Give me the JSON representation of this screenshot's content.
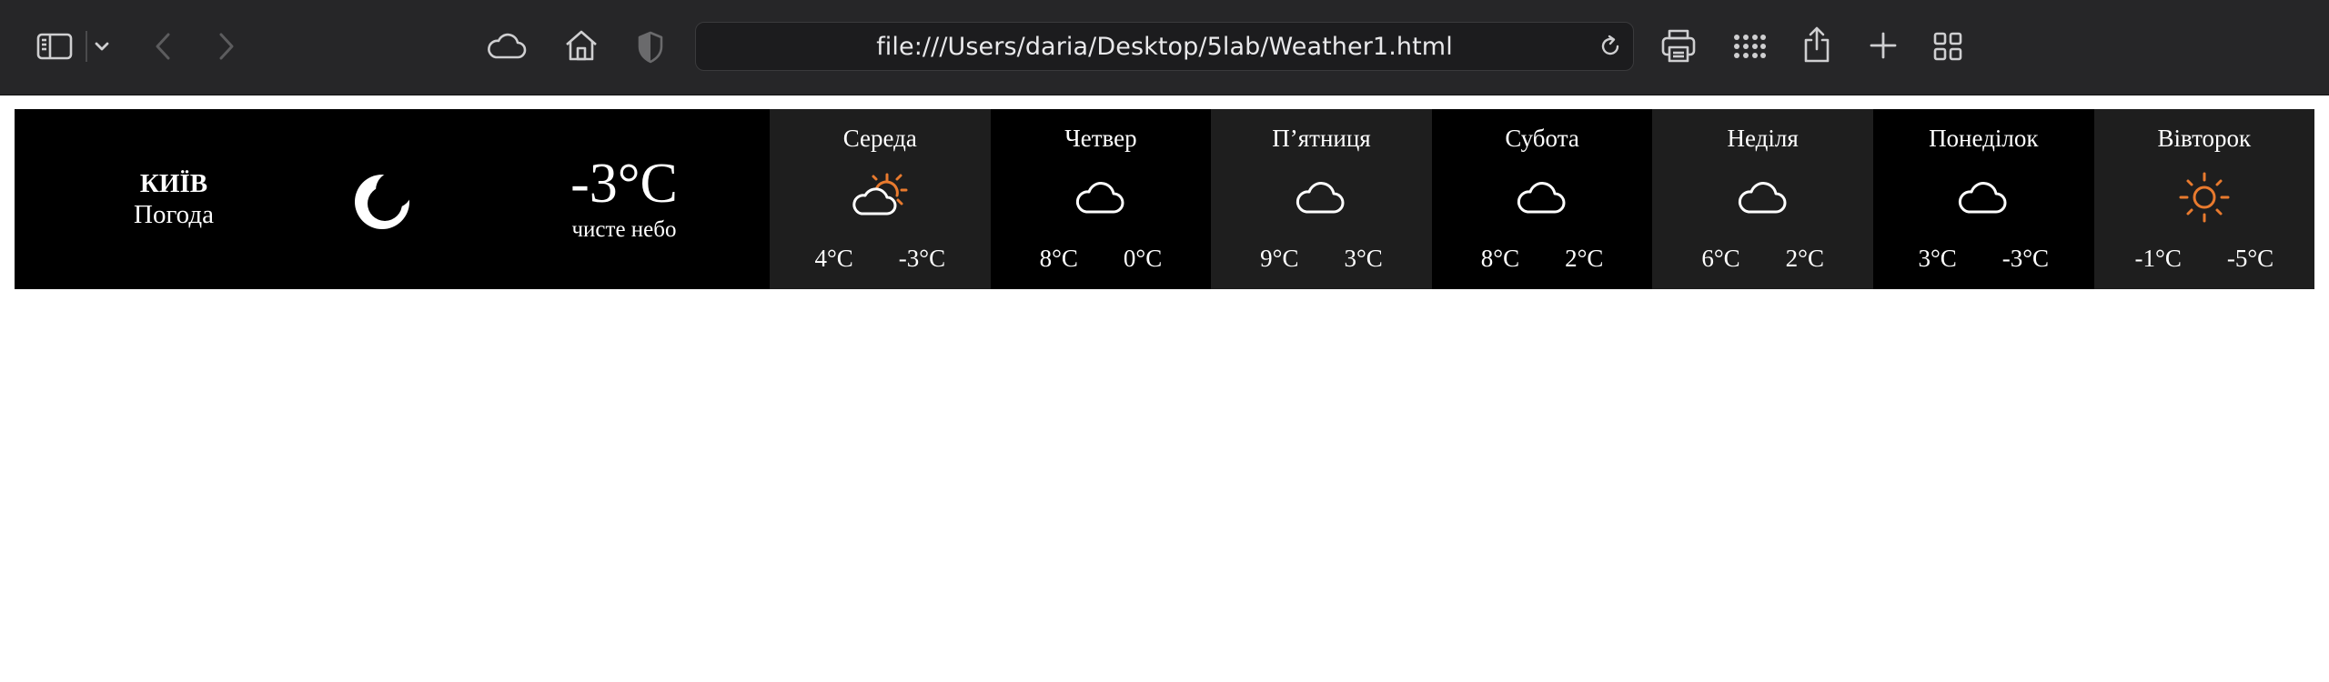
{
  "browser": {
    "url": "file:///Users/daria/Desktop/5lab/Weather1.html",
    "icons": {
      "sidebar": "sidebar-icon",
      "tabgroup_chevron": "chevron-down-icon",
      "back": "back-arrow-icon",
      "forward": "forward-arrow-icon",
      "icloud": "cloud-icon",
      "home": "home-icon",
      "privacy": "shield-icon",
      "reload": "reload-icon",
      "print": "printer-icon",
      "extensions": "grid-dots-icon",
      "share": "share-icon",
      "new_tab": "plus-icon",
      "tab_overview": "tab-overview-icon"
    }
  },
  "weather": {
    "city": "КИЇВ",
    "subtitle": "Погода",
    "current": {
      "icon": "moon-icon",
      "temp": "-3°C",
      "description": "чисте небо"
    },
    "forecast": [
      {
        "day": "Середа",
        "icon": "cloud-sun-icon",
        "high": "4°C",
        "low": "-3°C"
      },
      {
        "day": "Четвер",
        "icon": "cloud-icon",
        "high": "8°C",
        "low": "0°C"
      },
      {
        "day": "П’ятниця",
        "icon": "cloud-icon",
        "high": "9°C",
        "low": "3°C"
      },
      {
        "day": "Субота",
        "icon": "cloud-icon",
        "high": "8°C",
        "low": "2°C"
      },
      {
        "day": "Неділя",
        "icon": "cloud-icon",
        "high": "6°C",
        "low": "2°C"
      },
      {
        "day": "Понеділок",
        "icon": "cloud-icon",
        "high": "3°C",
        "low": "-3°C"
      },
      {
        "day": "Вівторок",
        "icon": "sun-icon",
        "high": "-1°C",
        "low": "-5°C"
      }
    ],
    "colors": {
      "background": "#000000",
      "alt_background": "#1e1e1e",
      "text": "#ffffff",
      "sun_accent": "#e87a2e"
    }
  }
}
